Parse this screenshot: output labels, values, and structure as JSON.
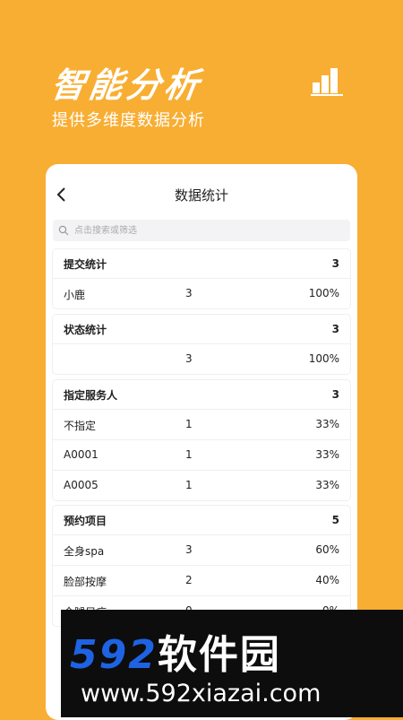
{
  "hero": {
    "title": "智能分析",
    "subtitle": "提供多维度数据分析",
    "icon": "bar-chart-icon",
    "accent": "#F8AE33"
  },
  "screen": {
    "title": "数据统计",
    "back_icon": "chevron-left-icon",
    "search_placeholder": "点击搜索或筛选",
    "sections": [
      {
        "title": "提交统计",
        "total": "3",
        "rows": [
          {
            "name": "小鹿",
            "count": "3",
            "percent": "100%"
          }
        ]
      },
      {
        "title": "状态统计",
        "total": "3",
        "rows": [
          {
            "name": "",
            "count": "3",
            "percent": "100%"
          }
        ]
      },
      {
        "title": "指定服务人",
        "total": "3",
        "rows": [
          {
            "name": "不指定",
            "count": "1",
            "percent": "33%"
          },
          {
            "name": "A0001",
            "count": "1",
            "percent": "33%"
          },
          {
            "name": "A0005",
            "count": "1",
            "percent": "33%"
          }
        ]
      },
      {
        "title": "预约项目",
        "total": "5",
        "rows": [
          {
            "name": "全身spa",
            "count": "3",
            "percent": "60%"
          },
          {
            "name": "脸部按摩",
            "count": "2",
            "percent": "40%"
          },
          {
            "name": "全腿足疗",
            "count": "0",
            "percent": "0%"
          }
        ]
      }
    ]
  },
  "watermark": {
    "logo_digits": "592",
    "logo_text": "软件园",
    "url": "www.592xiazai.com",
    "logo_color": "#1E63E4"
  }
}
